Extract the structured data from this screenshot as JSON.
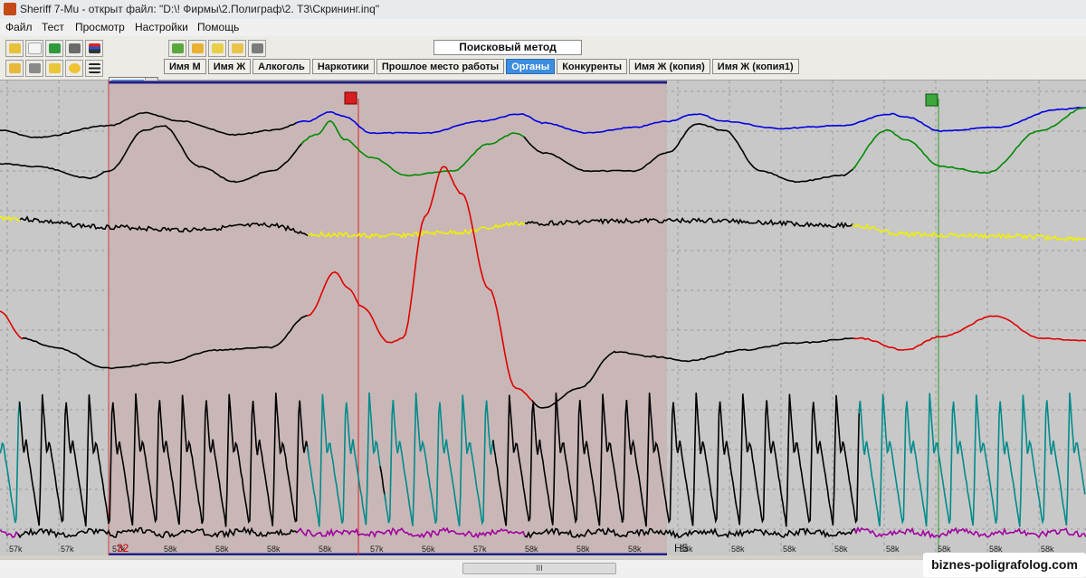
{
  "window": {
    "title": "Sheriff 7-Mu - открыт файл: \"D:\\! Фирмы\\2.Полиграф\\2. Т3\\Скрининг.inq\""
  },
  "menu": [
    "Файл",
    "Тест",
    "Просмотр",
    "Настройки",
    "Помощь"
  ],
  "method_title": "Поисковый метод",
  "tabs": [
    {
      "label": "Имя М",
      "active": false
    },
    {
      "label": "Имя Ж",
      "active": false
    },
    {
      "label": "Алкоголь",
      "active": false
    },
    {
      "label": "Наркотики",
      "active": false
    },
    {
      "label": "Прошлое место работы",
      "active": false
    },
    {
      "label": "Органы",
      "active": true
    },
    {
      "label": "Конкуренты",
      "active": false
    },
    {
      "label": "Имя Ж (копия)",
      "active": false
    },
    {
      "label": "Имя Ж (копия1)",
      "active": false
    }
  ],
  "chart": {
    "time_labels": [
      "57k",
      "57k",
      "57k",
      "58k",
      "58k",
      "58k",
      "58k",
      "57k",
      "56k",
      "57k",
      "58k",
      "58k",
      "58k",
      "58k",
      "58k",
      "58k",
      "58k",
      "58k",
      "58k",
      "58k",
      "58k"
    ],
    "question_number": "32",
    "marker_label": "Н5",
    "colors": {
      "background": "#c8c8c8",
      "selection": "#c9b7b7",
      "respiration_upper": "#0000e0",
      "respiration_lower": "#008a00",
      "gsr_highlight": "#f0f000",
      "cardio": "#e00000",
      "pleth": "#008b8b",
      "motion": "#a000a0",
      "trace": "#000000"
    }
  },
  "scrollbar": {
    "thumb_label": "III"
  },
  "watermark": "biznes-poligrafolog.com"
}
